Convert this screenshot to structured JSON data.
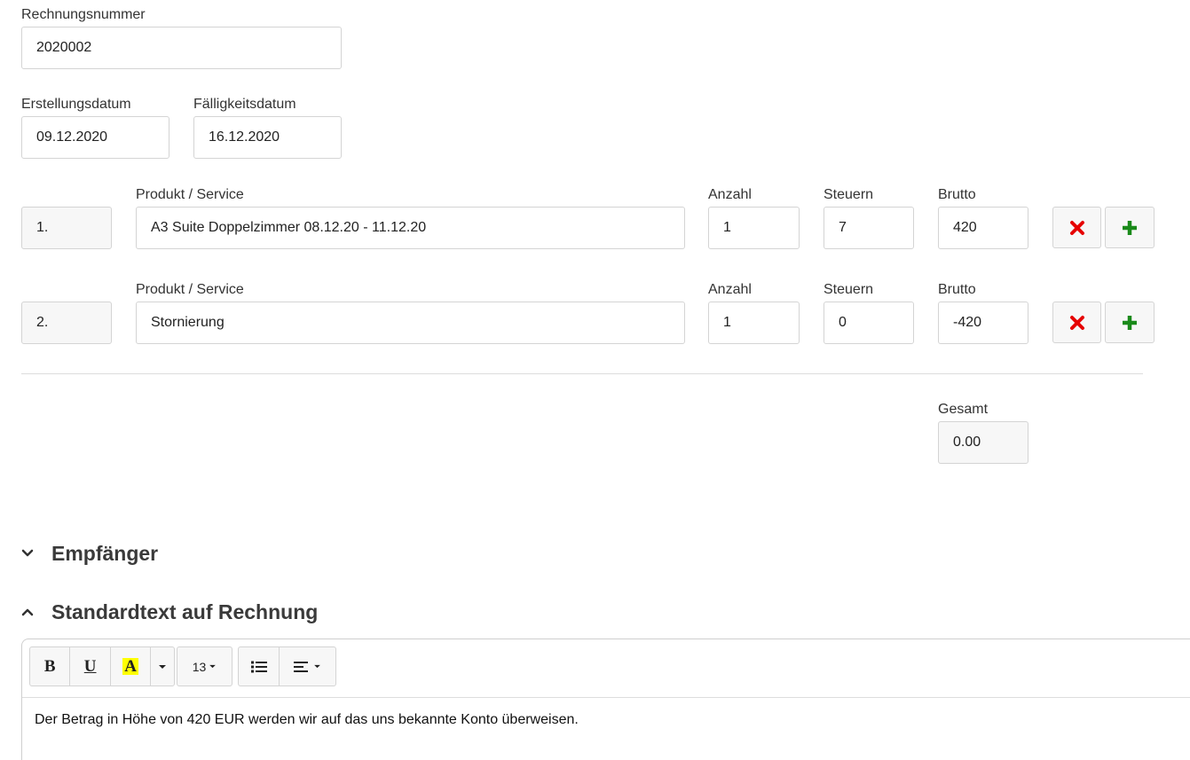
{
  "invoice": {
    "number_label": "Rechnungsnummer",
    "number_value": "2020002",
    "created_label": "Erstellungsdatum",
    "created_value": "09.12.2020",
    "due_label": "Fälligkeitsdatum",
    "due_value": "16.12.2020"
  },
  "items": [
    {
      "index": "1.",
      "product_label": "Produkt / Service",
      "product_value": "A3 Suite Doppelzimmer 08.12.20 - 11.12.20",
      "qty_label": "Anzahl",
      "qty_value": "1",
      "tax_label": "Steuern",
      "tax_value": "7",
      "gross_label": "Brutto",
      "gross_value": "420"
    },
    {
      "index": "2.",
      "product_label": "Produkt / Service",
      "product_value": "Stornierung",
      "qty_label": "Anzahl",
      "qty_value": "1",
      "tax_label": "Steuern",
      "tax_value": "0",
      "gross_label": "Brutto",
      "gross_value": "-420"
    }
  ],
  "total": {
    "label": "Gesamt",
    "value": "0.00"
  },
  "sections": {
    "recipient_title": "Empfänger",
    "standard_text_title": "Standardtext auf Rechnung"
  },
  "editor": {
    "bold": "B",
    "underline": "U",
    "highlight": "A",
    "font_size": "13",
    "content": "Der Betrag in Höhe von 420 EUR werden wir auf das uns bekannte Konto überweisen."
  },
  "icons": {
    "remove": "close-icon",
    "add": "plus-icon",
    "collapsed": "chevron-down-icon",
    "expanded": "chevron-up-icon",
    "list": "list-icon",
    "align": "align-icon"
  },
  "colors": {
    "remove": "#e60000",
    "add": "#1a8a1a",
    "highlight": "#ffff00"
  }
}
